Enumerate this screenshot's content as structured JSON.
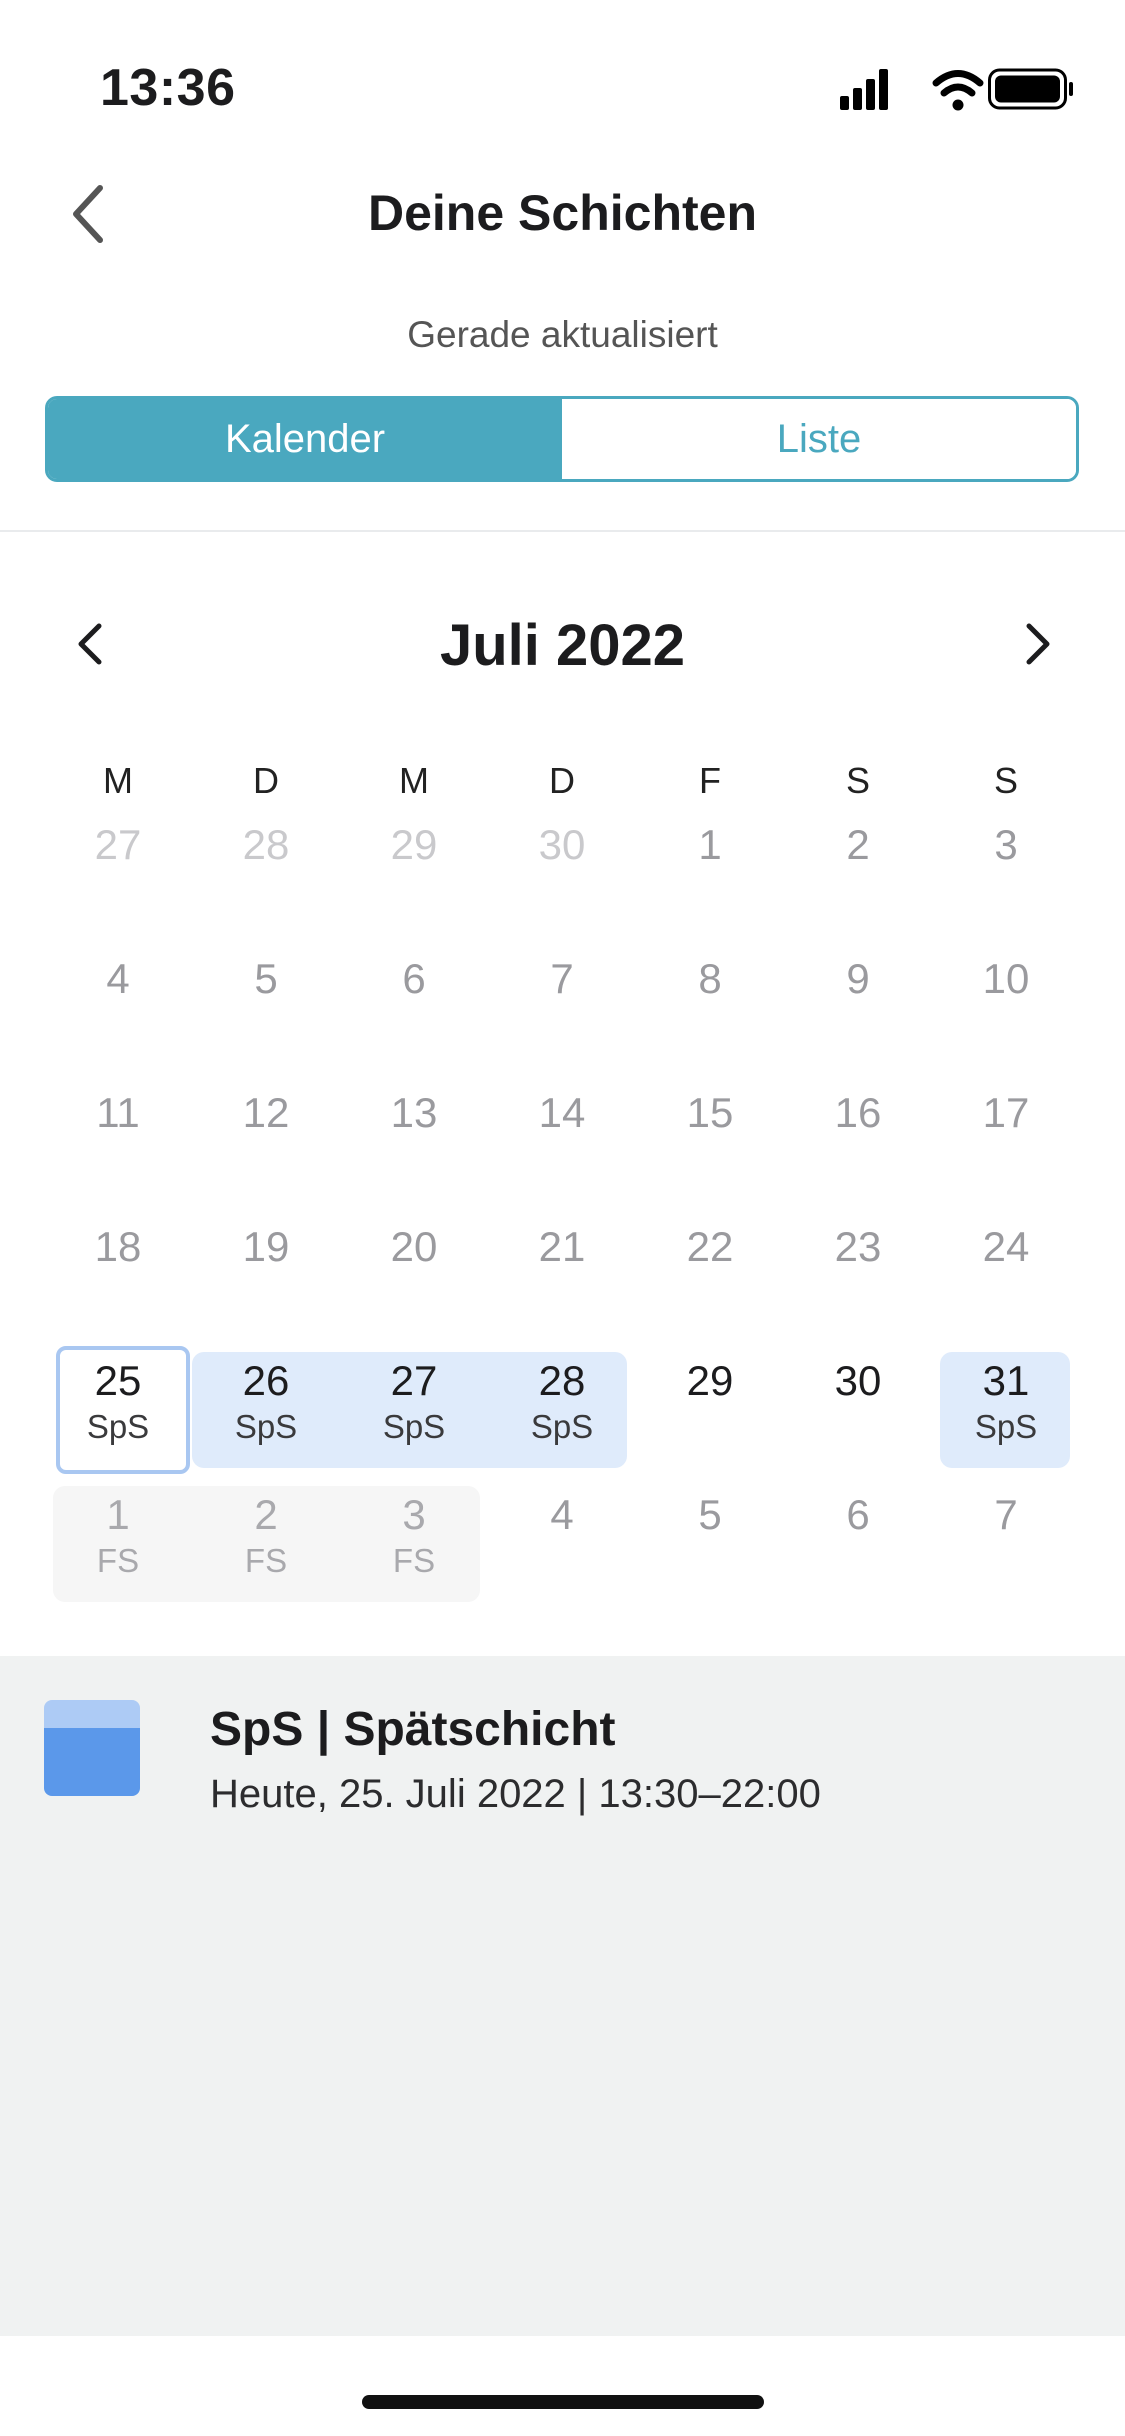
{
  "status_bar": {
    "time": "13:36",
    "icons": [
      "signal-icon",
      "wifi-icon",
      "battery-icon"
    ]
  },
  "header": {
    "title": "Deine Schichten",
    "updated": "Gerade aktualisiert"
  },
  "tabs": [
    {
      "label": "Kalender",
      "active": true
    },
    {
      "label": "Liste",
      "active": false
    }
  ],
  "calendar": {
    "month_label": "Juli 2022",
    "weekdays": [
      "M",
      "D",
      "M",
      "D",
      "F",
      "S",
      "S"
    ],
    "weeks": [
      [
        {
          "d": "27",
          "s": "muted"
        },
        {
          "d": "28",
          "s": "muted"
        },
        {
          "d": "29",
          "s": "muted"
        },
        {
          "d": "30",
          "s": "muted"
        },
        {
          "d": "1",
          "s": "past"
        },
        {
          "d": "2",
          "s": "past"
        },
        {
          "d": "3",
          "s": "past"
        }
      ],
      [
        {
          "d": "4",
          "s": "past"
        },
        {
          "d": "5",
          "s": "past"
        },
        {
          "d": "6",
          "s": "past"
        },
        {
          "d": "7",
          "s": "past"
        },
        {
          "d": "8",
          "s": "past"
        },
        {
          "d": "9",
          "s": "past"
        },
        {
          "d": "10",
          "s": "past"
        }
      ],
      [
        {
          "d": "11",
          "s": "past"
        },
        {
          "d": "12",
          "s": "past"
        },
        {
          "d": "13",
          "s": "past"
        },
        {
          "d": "14",
          "s": "past"
        },
        {
          "d": "15",
          "s": "past"
        },
        {
          "d": "16",
          "s": "past"
        },
        {
          "d": "17",
          "s": "past"
        }
      ],
      [
        {
          "d": "18",
          "s": "past"
        },
        {
          "d": "19",
          "s": "past"
        },
        {
          "d": "20",
          "s": "past"
        },
        {
          "d": "21",
          "s": "past"
        },
        {
          "d": "22",
          "s": "past"
        },
        {
          "d": "23",
          "s": "past"
        },
        {
          "d": "24",
          "s": "past"
        }
      ],
      [
        {
          "d": "25",
          "s": "shift",
          "label": "SpS",
          "today": true
        },
        {
          "d": "26",
          "s": "shift",
          "label": "SpS"
        },
        {
          "d": "27",
          "s": "shift",
          "label": "SpS"
        },
        {
          "d": "28",
          "s": "shift",
          "label": "SpS"
        },
        {
          "d": "29",
          "s": "future"
        },
        {
          "d": "30",
          "s": "future"
        },
        {
          "d": "31",
          "s": "shift",
          "label": "SpS"
        }
      ],
      [
        {
          "d": "1",
          "s": "off",
          "label": "FS"
        },
        {
          "d": "2",
          "s": "off",
          "label": "FS"
        },
        {
          "d": "3",
          "s": "off",
          "label": "FS"
        },
        {
          "d": "4",
          "s": "past"
        },
        {
          "d": "5",
          "s": "past"
        },
        {
          "d": "6",
          "s": "past"
        },
        {
          "d": "7",
          "s": "past"
        }
      ]
    ]
  },
  "selected_shift": {
    "title": "SpS | Spätschicht",
    "time": "Heute, 25. Juli 2022 | 13:30–22:00",
    "color_light": "#adcbf5",
    "color_dark": "#5b98ea"
  },
  "colors": {
    "accent": "#4aa8bf",
    "shift_band": "#dfebfb",
    "off_band": "#f6f6f6",
    "today_ring": "#a9c7f1"
  }
}
